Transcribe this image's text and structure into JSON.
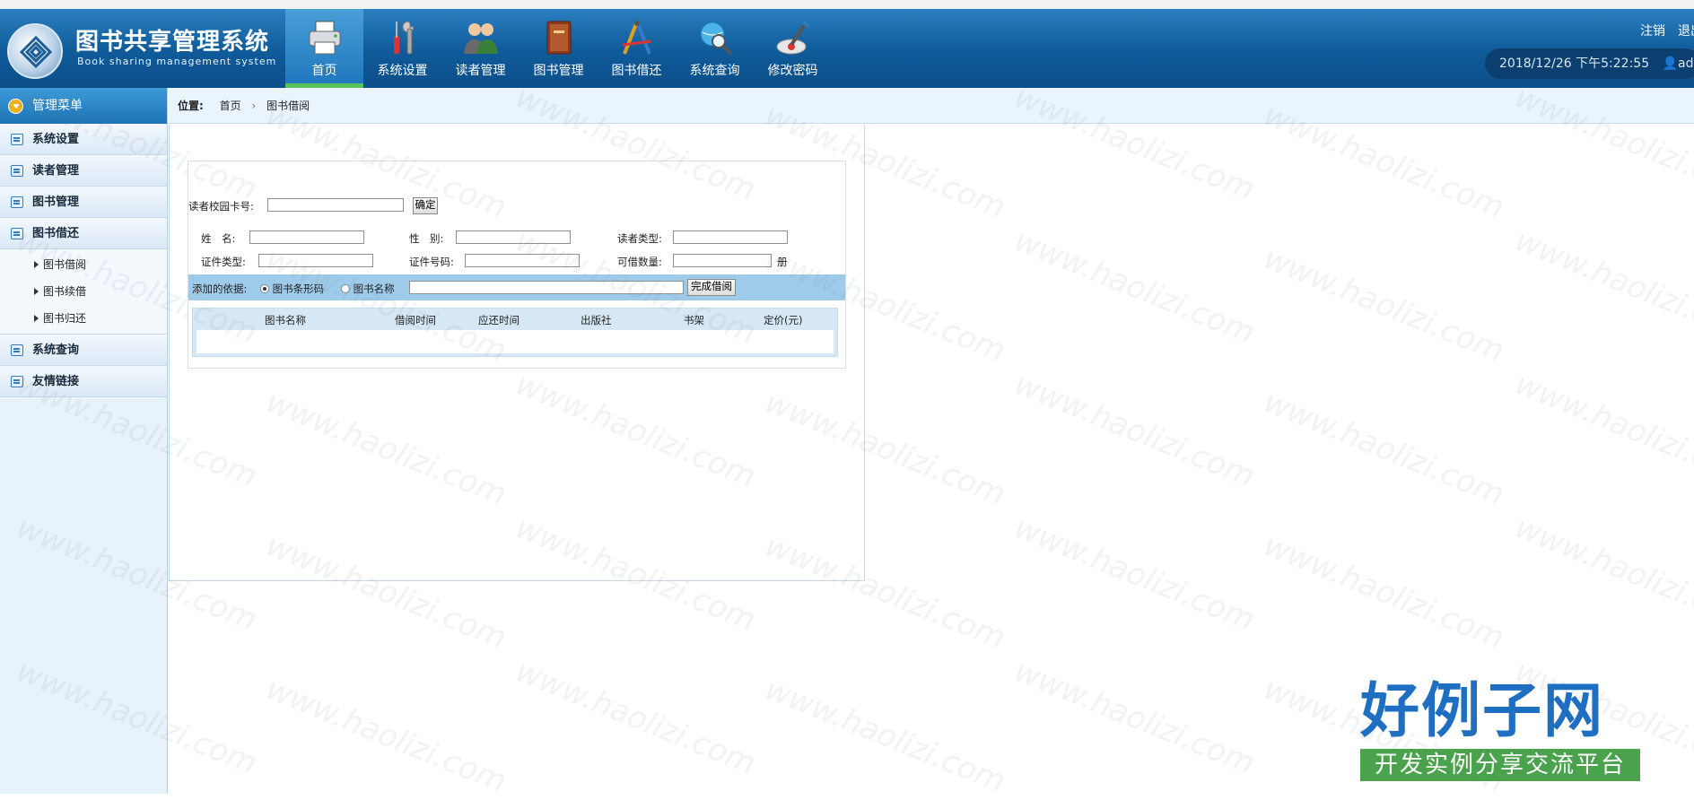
{
  "app": {
    "title": "图书共享管理系统",
    "subtitle": "Book sharing management system"
  },
  "nav": [
    {
      "label": "首页",
      "icon": "printer-icon",
      "active": true
    },
    {
      "label": "系统设置",
      "icon": "tools-icon"
    },
    {
      "label": "读者管理",
      "icon": "users-icon"
    },
    {
      "label": "图书管理",
      "icon": "book-icon"
    },
    {
      "label": "图书借还",
      "icon": "drafting-icon"
    },
    {
      "label": "系统查询",
      "icon": "globe-search-icon"
    },
    {
      "label": "修改密码",
      "icon": "pen-icon"
    }
  ],
  "header": {
    "logout": "注销",
    "exit": "退出",
    "datetime": "2018/12/26 下午5:22:55",
    "user": "admin"
  },
  "sidebar": {
    "title": "管理菜单",
    "items": [
      {
        "label": "系统设置"
      },
      {
        "label": "读者管理"
      },
      {
        "label": "图书管理"
      },
      {
        "label": "图书借还",
        "children": [
          "图书借阅",
          "图书续借",
          "图书归还"
        ]
      },
      {
        "label": "系统查询"
      },
      {
        "label": "友情链接"
      }
    ]
  },
  "breadcrumb": {
    "prefix": "位置:",
    "home": "首页",
    "separator": "›",
    "current": "图书借阅"
  },
  "form": {
    "card_label": "读者校园卡号:",
    "confirm_button": "确定",
    "name_label": "姓　名:",
    "gender_label": "性　别:",
    "reader_type_label": "读者类型:",
    "id_type_label": "证件类型:",
    "id_number_label": "证件号码:",
    "borrow_count_label": "可借数量:",
    "borrow_unit": "册",
    "add_by_label": "添加的依据:",
    "option_barcode": "图书条形码",
    "option_name": "图书名称",
    "finish_button": "完成借阅",
    "values": {
      "card": "",
      "name": "",
      "gender": "",
      "reader_type": "",
      "id_type": "",
      "id_number": "",
      "borrow_count": "",
      "book_key": ""
    },
    "selected_option": "图书条形码"
  },
  "table": {
    "columns": [
      "图书名称",
      "借阅时间",
      "应还时间",
      "出版社",
      "书架",
      "定价(元)"
    ],
    "rows": []
  },
  "watermark": "www.haolizi.com",
  "brand": {
    "title": "好例子网",
    "subtitle": "开发实例分享交流平台"
  },
  "colors": {
    "header": "#0f5a99",
    "active_tab_underline": "#57c35a",
    "sidebar_bg": "#e8f2fb",
    "form_bar": "#9fcbeb",
    "brand_blue": "#1e6fc2",
    "brand_green": "#4aa24c"
  }
}
